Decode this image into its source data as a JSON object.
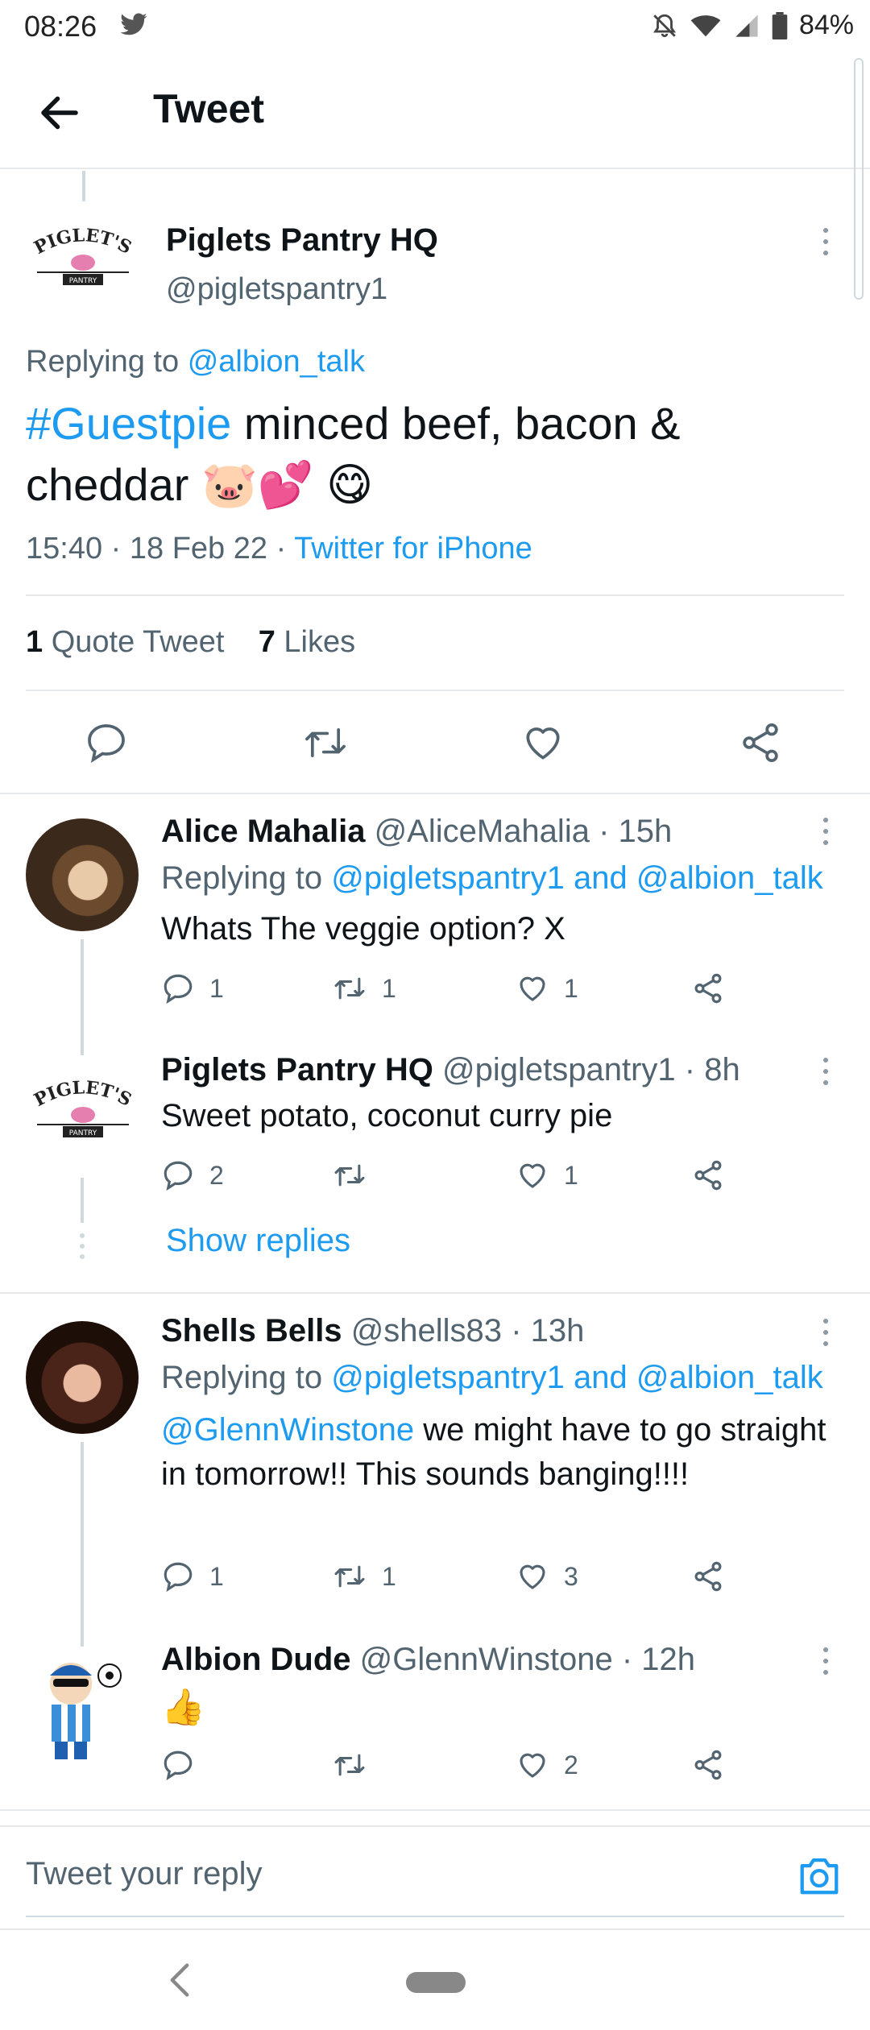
{
  "status_bar": {
    "time": "08:26",
    "battery": "84%"
  },
  "header": {
    "title": "Tweet"
  },
  "main_tweet": {
    "name": "Piglets Pantry HQ",
    "handle": "@pigletspantry1",
    "replying_label": "Replying to",
    "replying_to": "@albion_talk",
    "hashtag": "#Guestpie",
    "text": " minced beef, bacon & cheddar",
    "emoji": "🐷💕 😋",
    "time": "15:40",
    "date": "18 Feb 22",
    "client": "Twitter for iPhone",
    "quote_count": "1",
    "quote_label": "Quote Tweet",
    "likes_count": "7",
    "likes_label": "Likes",
    "logo_text": "PIGLET'S",
    "logo_sub": "PANTRY"
  },
  "replies": [
    {
      "name": "Alice Mahalia",
      "handle": "@AliceMahalia",
      "time": "· 15h",
      "replying_label": "Replying to",
      "replying_to": "@pigletspantry1 and @albion_talk",
      "text": "Whats The veggie option? X",
      "replies": "1",
      "retweets": "1",
      "likes": "1"
    },
    {
      "name": "Piglets Pantry HQ",
      "handle": "@pigletspantry1",
      "time": "· 8h",
      "text": "Sweet potato, coconut curry pie",
      "replies": "2",
      "retweets": "",
      "likes": "1",
      "show_replies": "Show replies"
    },
    {
      "name": "Shells Bells",
      "handle": "@shells83",
      "time": "· 13h",
      "replying_label": "Replying to",
      "replying_to": "@pigletspantry1 and @albion_talk",
      "mention": "@GlennWinstone",
      "text": " we might have to go straight in tomorrow!! This sounds banging!!!!",
      "replies": "1",
      "retweets": "1",
      "likes": "3"
    },
    {
      "name": "Albion Dude",
      "handle": "@GlennWinstone",
      "time": "· 12h",
      "text": "👍",
      "replies": "",
      "retweets": "",
      "likes": "2"
    }
  ],
  "reply_box": {
    "placeholder": "Tweet your reply"
  },
  "colors": {
    "accent": "#1d9bf0",
    "text": "#0f1419",
    "secondary": "#536471",
    "divider": "#e7e9ea"
  },
  "icons": [
    "twitter-bird-icon",
    "mute-icon",
    "wifi-icon",
    "signal-icon",
    "battery-icon",
    "back-arrow-icon",
    "more-icon",
    "reply-icon",
    "retweet-icon",
    "like-icon",
    "share-icon",
    "camera-icon"
  ]
}
